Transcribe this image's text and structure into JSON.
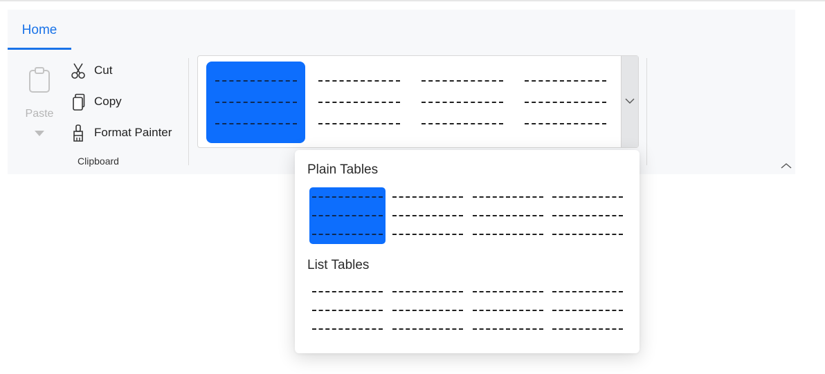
{
  "tabs": [
    {
      "label": "Home",
      "active": true
    }
  ],
  "clipboard": {
    "paste_label": "Paste",
    "cut_label": "Cut",
    "copy_label": "Copy",
    "format_painter_label": "Format Painter",
    "group_label": "Clipboard"
  },
  "table_styles_gallery": {
    "visible_count": 4,
    "selected_index": 0
  },
  "dropdown": {
    "sections": [
      {
        "heading": "Plain Tables",
        "count": 4,
        "selected_index": 0
      },
      {
        "heading": "List Tables",
        "count": 4,
        "selected_index": null
      }
    ]
  },
  "icons": {
    "paste": "clipboard-icon",
    "cut": "scissors-icon",
    "copy": "copy-icon",
    "format_painter": "paintbrush-icon",
    "expand": "chevron-down-icon",
    "collapse": "chevron-up-icon"
  },
  "colors": {
    "accent": "#1a73e8",
    "selected_style": "#0d6efd",
    "ribbon_bg": "#f7f8fa"
  }
}
